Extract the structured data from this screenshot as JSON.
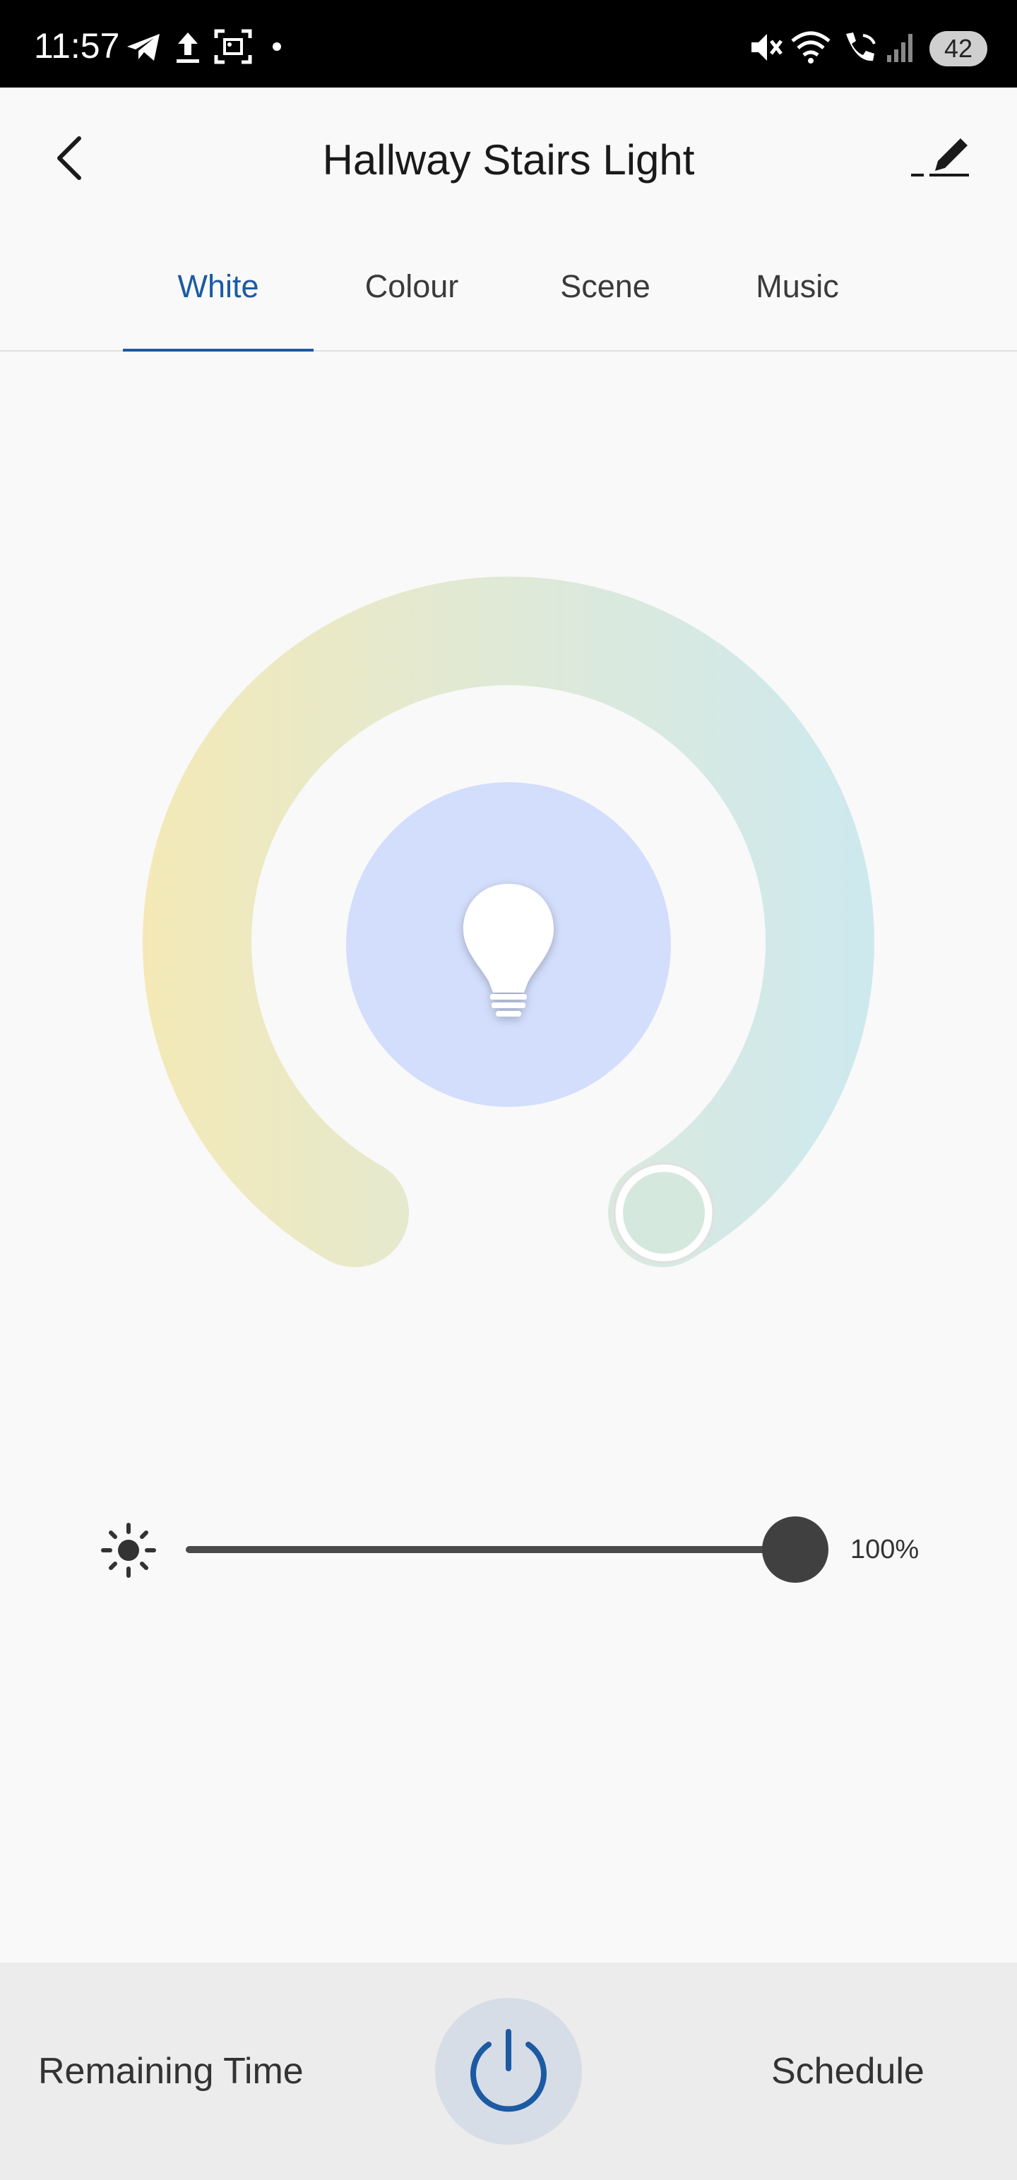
{
  "status_bar": {
    "time": "11:57",
    "battery": "42",
    "icons": [
      "telegram-icon",
      "upload-icon",
      "screenshot-icon",
      "dot-icon",
      "mute-icon",
      "wifi-icon",
      "wifi-call-icon",
      "signal-icon"
    ]
  },
  "header": {
    "title": "Hallway Stairs Light",
    "back_icon": "chevron-left-icon",
    "edit_icon": "pencil-icon"
  },
  "tabs": [
    {
      "label": "White",
      "active": true
    },
    {
      "label": "Colour",
      "active": false
    },
    {
      "label": "Scene",
      "active": false
    },
    {
      "label": "Music",
      "active": false
    }
  ],
  "dial": {
    "warm_color": "#f4e9b6",
    "cool_color": "#cde9ef",
    "center_color": "#d3defc",
    "temperature_level": 0.83
  },
  "brightness": {
    "icon": "sun-icon",
    "value": 1.0,
    "label": "100%"
  },
  "bottom_bar": {
    "remaining_time_label": "Remaining Time",
    "schedule_label": "Schedule",
    "power_icon": "power-icon"
  },
  "colors": {
    "accent": "#1c5aa3",
    "slider_track": "#4a4a4a"
  }
}
